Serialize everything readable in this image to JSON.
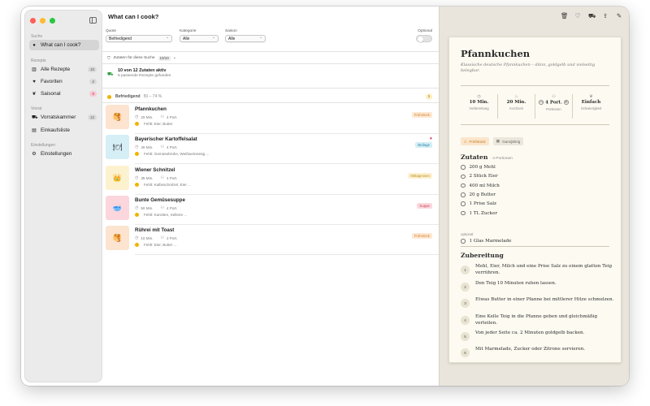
{
  "window": {
    "title": "What can I cook?"
  },
  "sidebar": {
    "sections": [
      {
        "label": "Suche",
        "items": [
          {
            "label": "What can I cook?",
            "icon": "magnifier-icon",
            "active": true
          }
        ]
      },
      {
        "label": "Rezepte",
        "items": [
          {
            "label": "Alle Rezepte",
            "icon": "book-icon",
            "count": "10"
          },
          {
            "label": "Favoriten",
            "icon": "heart-icon",
            "count": "2"
          },
          {
            "label": "Saisonal",
            "icon": "leaf-icon",
            "count": "8"
          }
        ]
      },
      {
        "label": "Vorrat",
        "items": [
          {
            "label": "Vorratskammer",
            "icon": "cart-icon",
            "count": "12"
          },
          {
            "label": "Einkaufsliste",
            "icon": "list-icon"
          }
        ]
      },
      {
        "label": "Einstellungen",
        "items": [
          {
            "label": "Einstellungen",
            "icon": "gear-icon"
          }
        ]
      }
    ]
  },
  "filters": {
    "quote": {
      "label": "Quote",
      "value": "Befriedigend"
    },
    "kategorie": {
      "label": "Kategorie",
      "value": "Alle"
    },
    "saison": {
      "label": "Saison",
      "value": "Alle"
    },
    "optional": {
      "label": "Optional",
      "on": false
    },
    "zutaten_label": "Zutaten für diese Suche",
    "zutaten_badge": "10/10"
  },
  "summary": {
    "line1": "10 von 12 Zutaten aktiv",
    "line2": "5 passende Rezepte gefunden"
  },
  "group": {
    "name": "Befriedigend",
    "range": "50 – 74 %",
    "count": "5"
  },
  "recipes": [
    {
      "name": "Pfannkuchen",
      "time": "20 Min.",
      "portions": "4 Port.",
      "missing": "Fehlt: Eier, Butter",
      "tag": "Frühstück",
      "tag_bg": "#fde8d2",
      "tag_fg": "#d48632",
      "thumb_bg": "#fce4d0",
      "thumb": "🥞",
      "favorite": false
    },
    {
      "name": "Bayerischer Kartoffelsalat",
      "time": "40 Min.",
      "portions": "4 Port.",
      "missing": "Fehlt: Gemüsebrühe, Weißweinessig ...",
      "tag": "Beilage",
      "tag_bg": "#d4eef5",
      "tag_fg": "#2a8ba6",
      "thumb_bg": "#d6eef6",
      "thumb": "🍽",
      "favorite": true
    },
    {
      "name": "Wiener Schnitzel",
      "time": "35 Min.",
      "portions": "4 Port.",
      "missing": "Fehlt: Kalbsschnitzel, Eier ...",
      "tag": "Mittagessen",
      "tag_bg": "#fdf0cf",
      "tag_fg": "#b99222",
      "thumb_bg": "#fcf2cf",
      "thumb": "👑",
      "favorite": false
    },
    {
      "name": "Bunte Gemüsesuppe",
      "time": "50 Min.",
      "portions": "4 Port.",
      "missing": "Fehlt: Karotten, Sellerie ...",
      "tag": "Suppe",
      "tag_bg": "#fbd9de",
      "tag_fg": "#cc4459",
      "thumb_bg": "#fbd6dc",
      "thumb": "🥣",
      "favorite": false
    },
    {
      "name": "Rührei mit Toast",
      "time": "10 Min.",
      "portions": "2 Port.",
      "missing": "Fehlt: Eier, Butter ...",
      "tag": "Frühstück",
      "tag_bg": "#fde8d2",
      "tag_fg": "#d48632",
      "thumb_bg": "#fce4d0",
      "thumb": "🥞",
      "favorite": false
    }
  ],
  "detail": {
    "title": "Pfannkuchen",
    "subtitle": "Klassische deutsche Pfannkuchen – dünn, goldgelb und vielseitig belegbar.",
    "stats": [
      {
        "icon": "clock-icon",
        "value": "10 Min.",
        "label": "Vorbereitung"
      },
      {
        "icon": "flame-icon",
        "value": "20 Min.",
        "label": "Kochzeit"
      },
      {
        "icon": "people-icon",
        "value": "4 Port.",
        "label": "Portionen"
      },
      {
        "icon": "chef-hat-icon",
        "value": "Einfach",
        "label": "Schwierigkeit"
      }
    ],
    "chips": [
      "Frühstück",
      "Ganzjährig"
    ],
    "ingredients_title": "Zutaten",
    "ingredients_sub": "· 4 Portionen",
    "ingredients": [
      "200 g Mehl",
      "2 Stück Eier",
      "400 ml Milch",
      "20 g Butter",
      "1 Prise Salz",
      "1 TL Zucker"
    ],
    "optional_label": "optional",
    "optional_ingredients": [
      "1 Glas Marmelade"
    ],
    "steps_title": "Zubereitung",
    "steps": [
      "Mehl, Eier, Milch und eine Prise Salz zu einem glatten Teig verrühren.",
      "Den Teig 10 Minuten ruhen lassen.",
      "Etwas Butter in einer Pfanne bei mittlerer Hitze schmelzen.",
      "Eine Kelle Teig in die Pfanne geben und gleichmäßig verteilen.",
      "Von jeder Seite ca. 2 Minuten goldgelb backen.",
      "Mit Marmelade, Zucker oder Zitrone servieren."
    ]
  },
  "toolbar_icons": [
    "trash-icon",
    "heart-icon",
    "cart-add-icon",
    "share-icon",
    "pencil-icon"
  ],
  "colors": {
    "accent_yellow": "#f0b400",
    "favorite_red": "#d62a4c",
    "card_bg": "#fcfaf1",
    "detail_bg": "#e9e5dc"
  }
}
